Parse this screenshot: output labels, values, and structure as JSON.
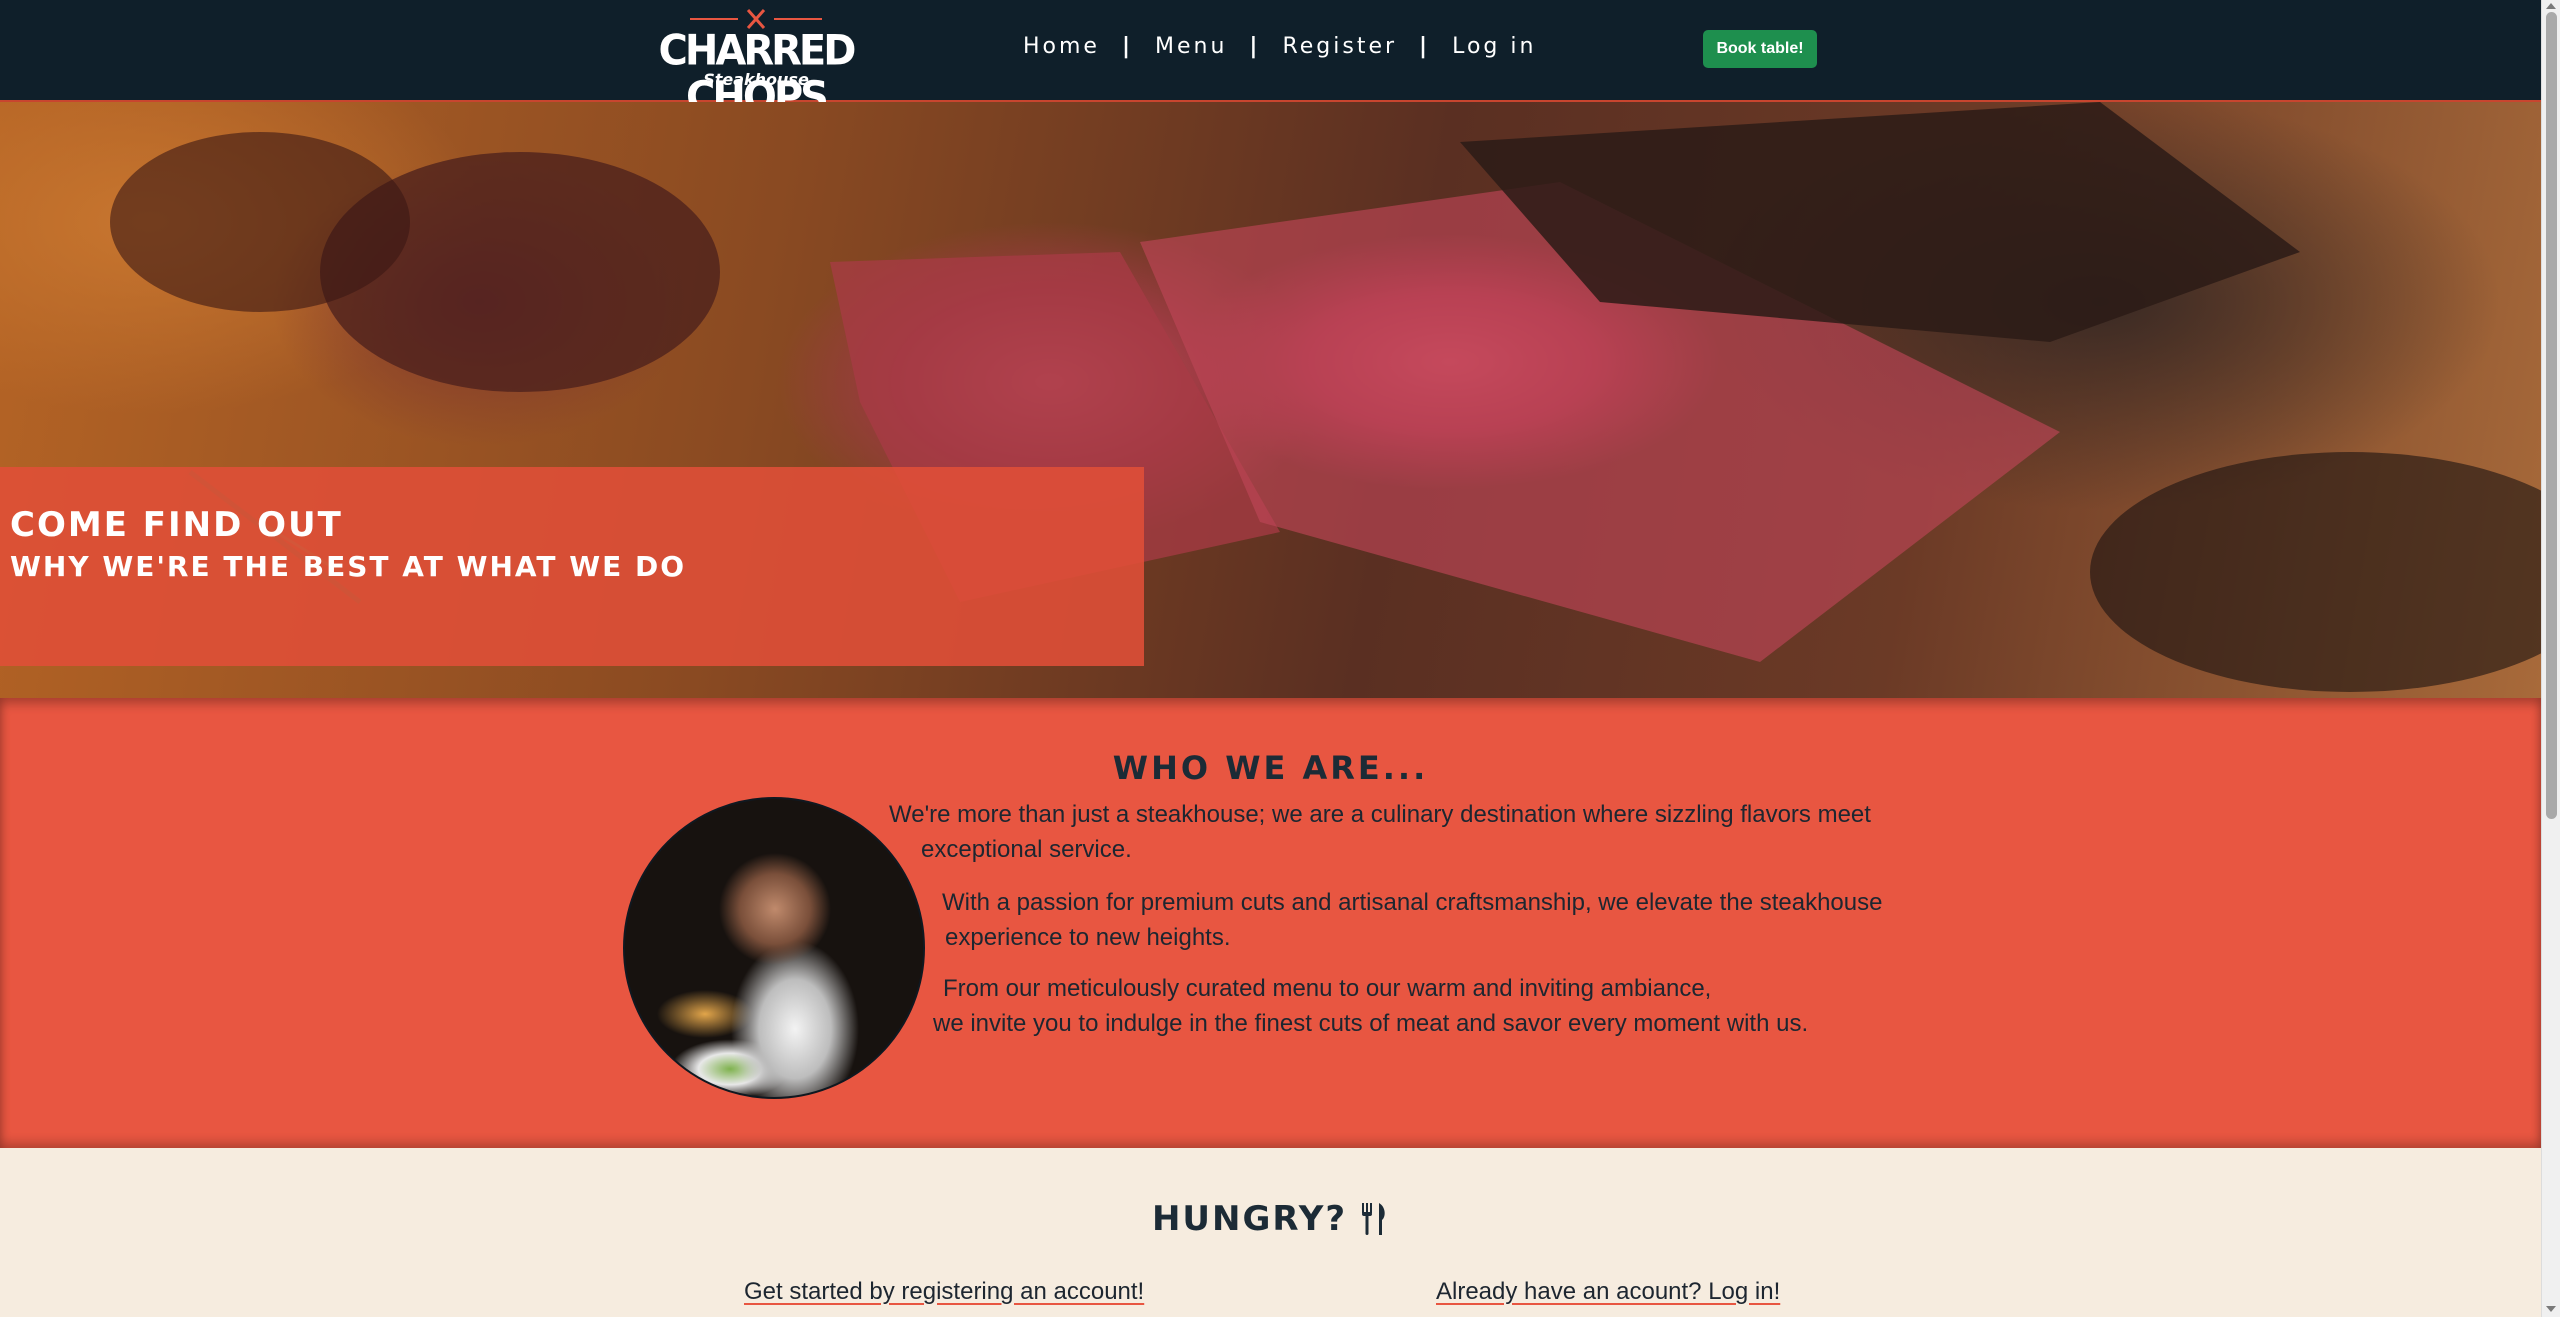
{
  "brand": {
    "name": "CHARRED CHOPS",
    "tagline": "Steakhouse"
  },
  "nav": {
    "items": [
      {
        "label": "Home"
      },
      {
        "label": "Menu"
      },
      {
        "label": "Register"
      },
      {
        "label": "Log in"
      }
    ],
    "separator": "|",
    "book_button": "Book table!"
  },
  "hero": {
    "title": "COME FIND OUT",
    "subtitle": "WHY WE'RE THE BEST AT WHAT WE DO"
  },
  "about": {
    "heading": "WHO WE ARE...",
    "lines": [
      "We're more than just a steakhouse; we are a culinary destination where sizzling flavors meet",
      "exceptional service.",
      "With a passion for premium cuts and artisanal craftsmanship, we elevate the steakhouse",
      "experience to new heights.",
      "From our meticulously curated menu to our warm and inviting ambiance,",
      "we invite you to indulge in the finest cuts of meat and savor every moment with us."
    ]
  },
  "hungry": {
    "heading": "HUNGRY?",
    "icon": "fork-knife-icon",
    "register_link": "Get started by registering an account!",
    "login_link": "Already have an acount? Log in!"
  },
  "colors": {
    "navbar": "#0f1f2a",
    "accent": "#e85641",
    "button": "#1e8f4e",
    "cream": "#f6ecdf"
  }
}
